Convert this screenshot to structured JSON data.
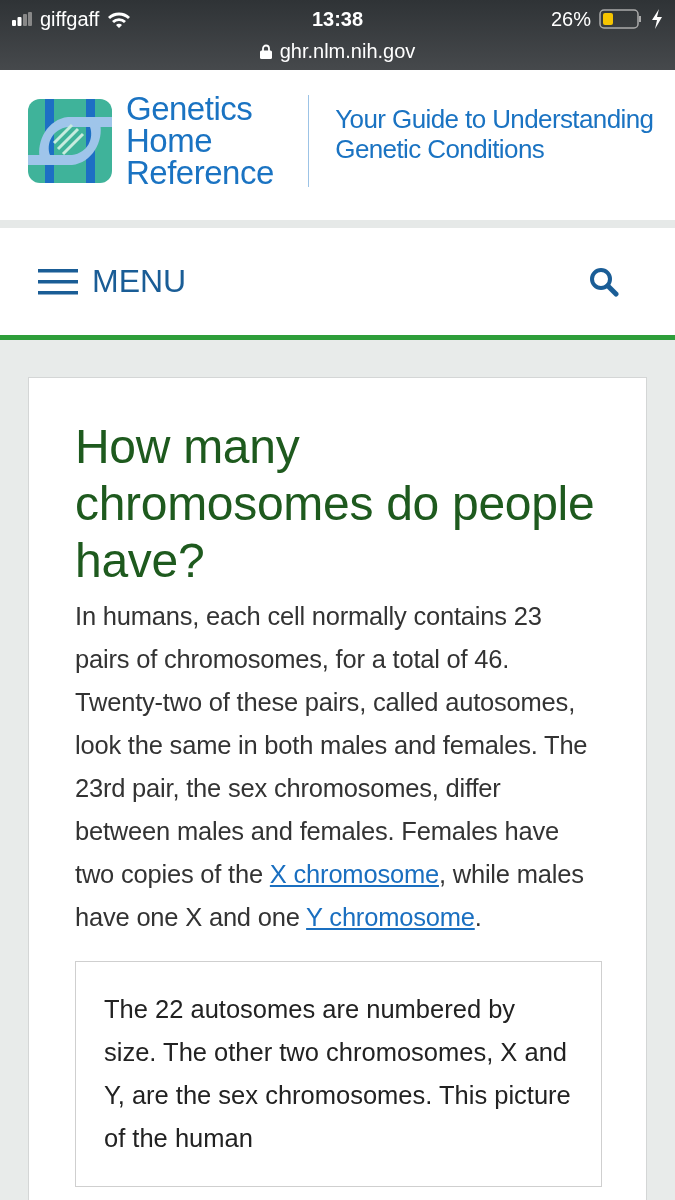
{
  "status_bar": {
    "carrier": "giffgaff",
    "time": "13:38",
    "battery": "26%",
    "url": "ghr.nlm.nih.gov"
  },
  "header": {
    "logo_lines": [
      "Genetics",
      "Home",
      "Reference"
    ],
    "tagline_lines": [
      "Your Guide to Understanding",
      "Genetic Conditions"
    ]
  },
  "nav": {
    "menu_label": "MENU"
  },
  "article": {
    "title": "How many chromosomes do people have?",
    "paragraph": [
      {
        "kind": "text",
        "text": "In humans, each cell normally contains 23 pairs of chromosomes, for a total of 46. Twenty-two of these pairs, called autosomes, look the same in both males and females. The 23rd pair, the sex chromosomes, differ between males and females. Females have two copies of the "
      },
      {
        "kind": "link",
        "text": "X chromosome"
      },
      {
        "kind": "text",
        "text": ", while males have one X and one "
      },
      {
        "kind": "link",
        "text": "Y chromosome"
      },
      {
        "kind": "text",
        "text": "."
      }
    ],
    "note": "The 22 autosomes are numbered by size. The other two chromosomes, X and Y, are the sex chromosomes. This picture of the human"
  }
}
